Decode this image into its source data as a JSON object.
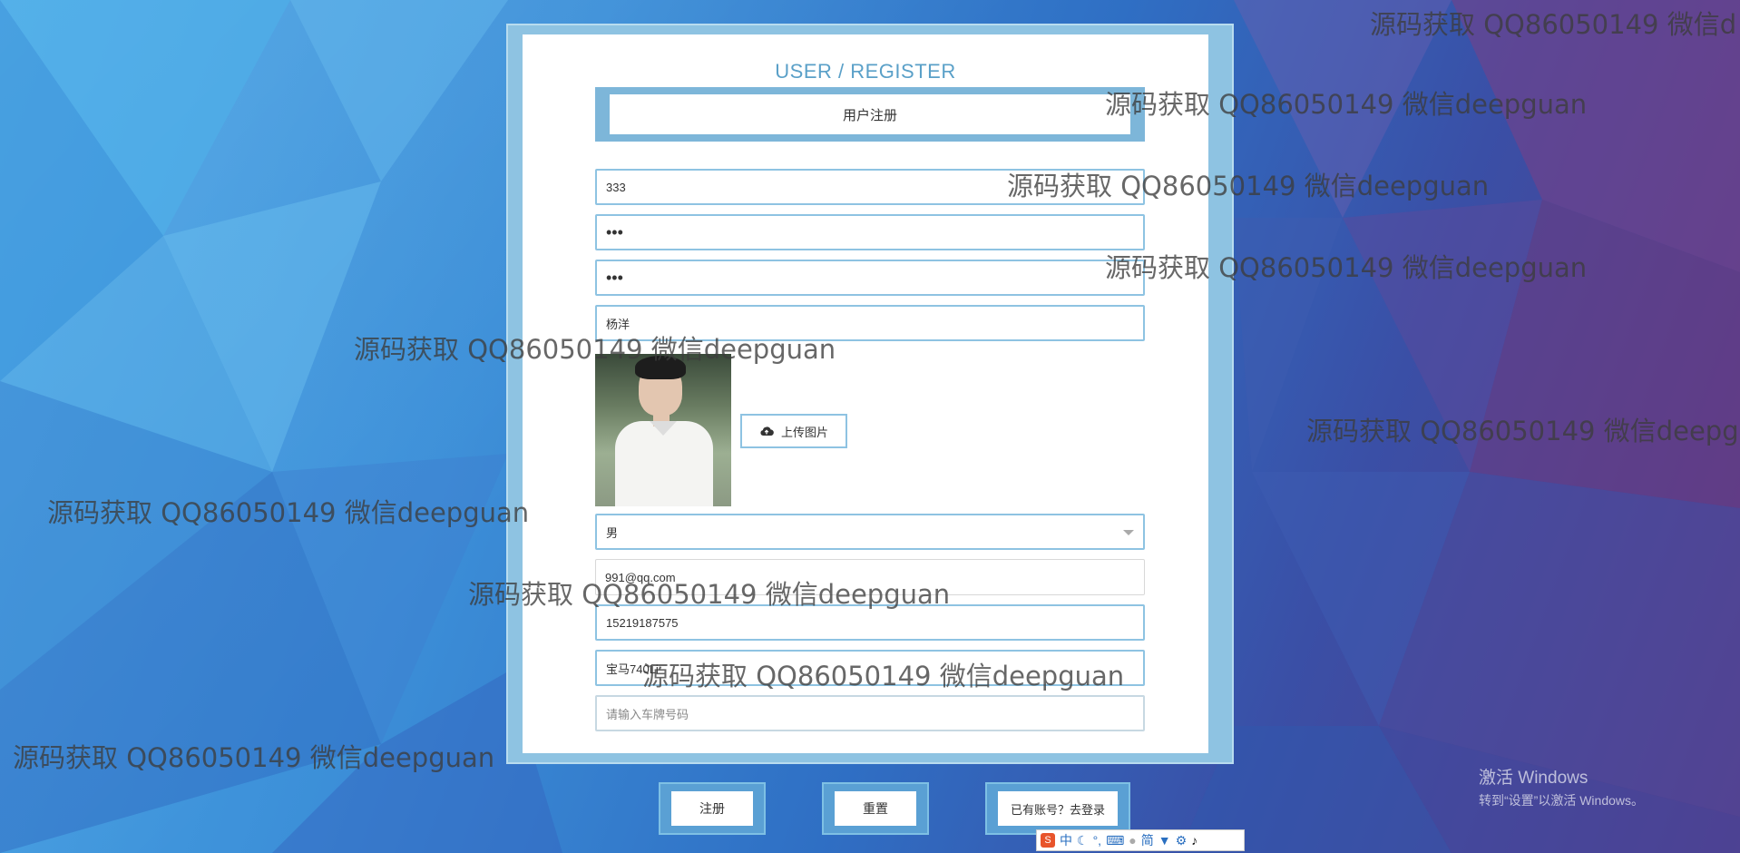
{
  "page": {
    "title": "USER / REGISTER",
    "form_header": "用户注册"
  },
  "form": {
    "username": "333",
    "password": "•••",
    "confirm_password": "•••",
    "name": "杨洋",
    "upload_label": "上传图片",
    "gender": "男",
    "email": "991@qq.com",
    "phone": "15219187575",
    "car_model": "宝马740Li",
    "plate_placeholder": "请输入车牌号码"
  },
  "actions": {
    "register": "注册",
    "reset": "重置",
    "login": "已有账号？去登录"
  },
  "watermark": {
    "text": "源码获取 QQ86050149 微信deepguan",
    "text_cut_top": "源码获取 QQ86050149 微信d",
    "text_cut_right": "源码获取 QQ86050149 微信deepg"
  },
  "system": {
    "activate_title": "激活 Windows",
    "activate_sub": "转到“设置”以激活 Windows。",
    "ime": {
      "logo": "S",
      "mode": "中",
      "simplified": "简"
    }
  },
  "colors": {
    "accent": "#8ec3e2",
    "title": "#5aa0c8",
    "button_frame": "#5aa0d4"
  }
}
